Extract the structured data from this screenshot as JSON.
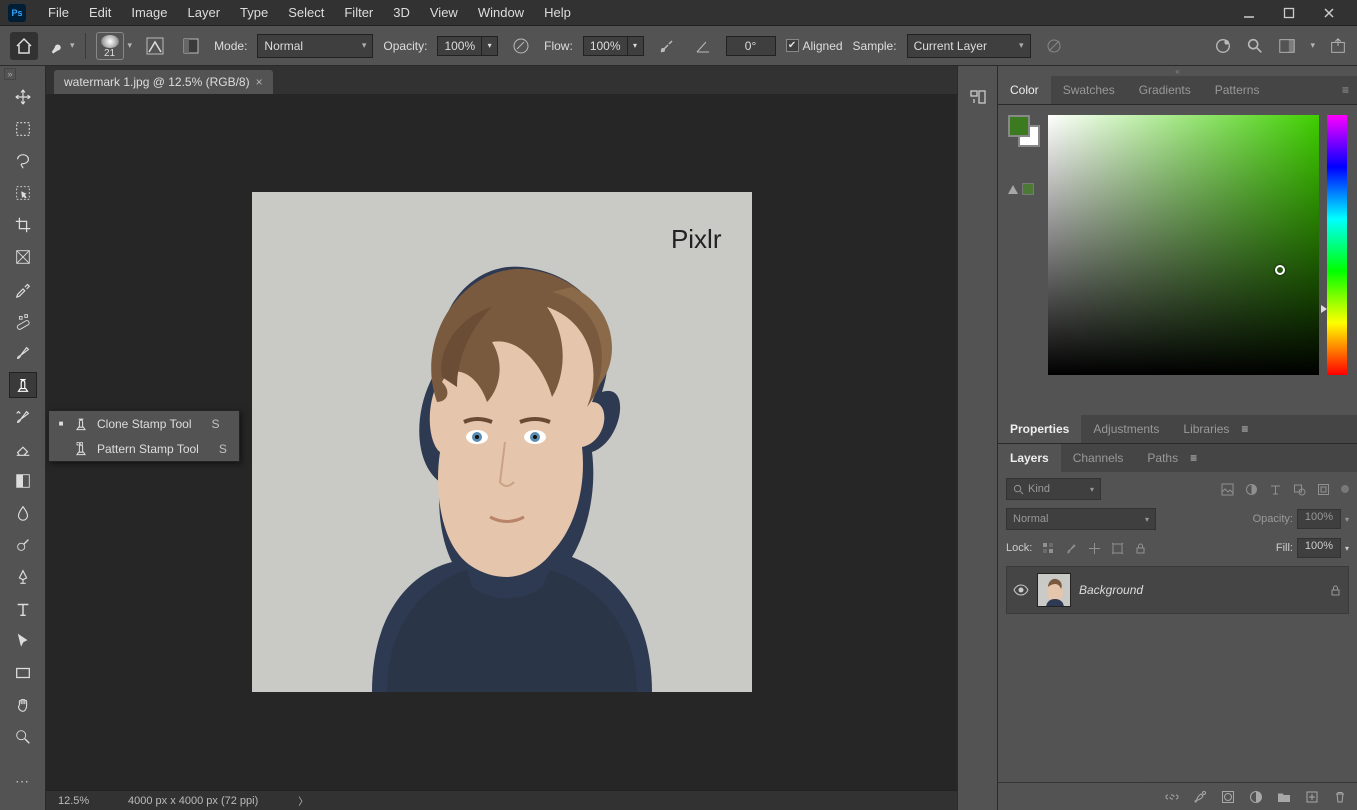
{
  "menubar": [
    "File",
    "Edit",
    "Image",
    "Layer",
    "Type",
    "Select",
    "Filter",
    "3D",
    "View",
    "Window",
    "Help"
  ],
  "options": {
    "brush_size": "21",
    "mode_label": "Mode:",
    "mode_value": "Normal",
    "opacity_label": "Opacity:",
    "opacity_value": "100%",
    "flow_label": "Flow:",
    "flow_value": "100%",
    "angle": "0°",
    "aligned_label": "Aligned",
    "sample_label": "Sample:",
    "sample_value": "Current Layer"
  },
  "document": {
    "tab_title": "watermark 1.jpg @ 12.5% (RGB/8)",
    "watermark_text": "Pixlr",
    "zoom": "12.5%",
    "dimensions": "4000 px x 4000 px (72 ppi)"
  },
  "flyout": {
    "items": [
      {
        "label": "Clone Stamp Tool",
        "shortcut": "S",
        "selected": true
      },
      {
        "label": "Pattern Stamp Tool",
        "shortcut": "S",
        "selected": false
      }
    ]
  },
  "panels": {
    "color_tabs": [
      "Color",
      "Swatches",
      "Gradients",
      "Patterns"
    ],
    "props_tabs": [
      "Properties",
      "Adjustments",
      "Libraries"
    ],
    "layer_tabs": [
      "Layers",
      "Channels",
      "Paths"
    ],
    "kind_label": "Kind",
    "blend_value": "Normal",
    "opacity_label": "Opacity:",
    "opacity_value": "100%",
    "lock_label": "Lock:",
    "fill_label": "Fill:",
    "fill_value": "100%",
    "layers": [
      {
        "name": "Background"
      }
    ]
  },
  "colors": {
    "foreground": "#3b7a1e",
    "background": "#ffffff"
  }
}
